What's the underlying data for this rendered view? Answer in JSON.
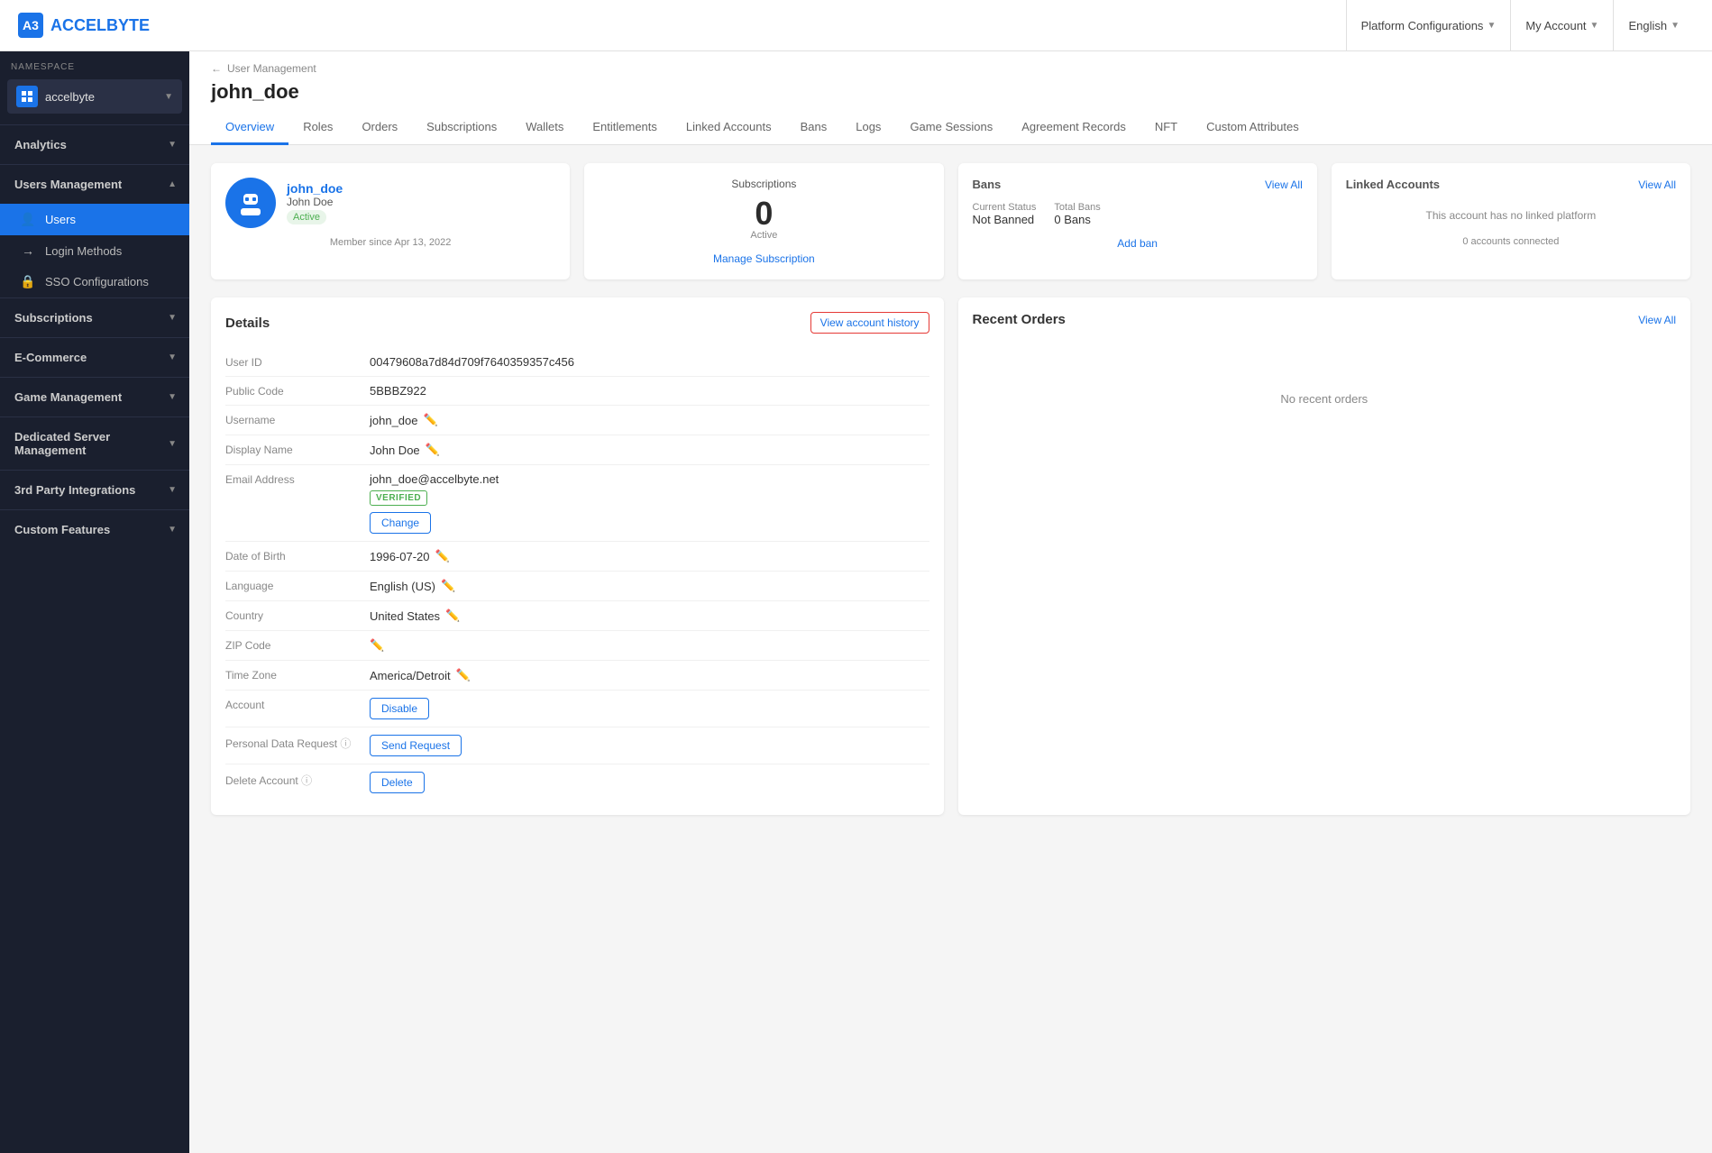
{
  "topnav": {
    "brand": "ACCELBYTE",
    "platform_configs_label": "Platform Configurations",
    "my_account_label": "My Account",
    "language_label": "English"
  },
  "sidebar": {
    "namespace_label": "NAMESPACE",
    "namespace_value": "accelbyte",
    "sections": [
      {
        "id": "analytics",
        "label": "Analytics",
        "expanded": false,
        "items": []
      },
      {
        "id": "users-management",
        "label": "Users Management",
        "expanded": true,
        "items": [
          {
            "id": "users",
            "label": "Users",
            "icon": "👤",
            "active": true
          },
          {
            "id": "login-methods",
            "label": "Login Methods",
            "icon": "🔑",
            "active": false
          },
          {
            "id": "sso-configurations",
            "label": "SSO Configurations",
            "icon": "🔒",
            "active": false
          }
        ]
      },
      {
        "id": "subscriptions",
        "label": "Subscriptions",
        "expanded": false,
        "items": []
      },
      {
        "id": "ecommerce",
        "label": "E-Commerce",
        "expanded": false,
        "items": []
      },
      {
        "id": "game-management",
        "label": "Game Management",
        "expanded": false,
        "items": []
      },
      {
        "id": "dedicated-server",
        "label": "Dedicated Server Management",
        "expanded": false,
        "items": []
      },
      {
        "id": "3rd-party",
        "label": "3rd Party Integrations",
        "expanded": false,
        "items": []
      },
      {
        "id": "custom-features",
        "label": "Custom Features",
        "expanded": false,
        "items": []
      }
    ]
  },
  "breadcrumb": {
    "parent": "User Management",
    "arrow": "←"
  },
  "page": {
    "title": "john_doe",
    "tabs": [
      {
        "id": "overview",
        "label": "Overview",
        "active": true
      },
      {
        "id": "roles",
        "label": "Roles",
        "active": false
      },
      {
        "id": "orders",
        "label": "Orders",
        "active": false
      },
      {
        "id": "subscriptions",
        "label": "Subscriptions",
        "active": false
      },
      {
        "id": "wallets",
        "label": "Wallets",
        "active": false
      },
      {
        "id": "entitlements",
        "label": "Entitlements",
        "active": false
      },
      {
        "id": "linked-accounts",
        "label": "Linked Accounts",
        "active": false
      },
      {
        "id": "bans",
        "label": "Bans",
        "active": false
      },
      {
        "id": "logs",
        "label": "Logs",
        "active": false
      },
      {
        "id": "game-sessions",
        "label": "Game Sessions",
        "active": false
      },
      {
        "id": "agreement-records",
        "label": "Agreement Records",
        "active": false
      },
      {
        "id": "nft",
        "label": "NFT",
        "active": false
      },
      {
        "id": "custom-attributes",
        "label": "Custom Attributes",
        "active": false
      }
    ]
  },
  "user_card": {
    "username": "john_doe",
    "display_name": "John Doe",
    "status": "Active",
    "member_since": "Member since Apr 13, 2022"
  },
  "subscriptions_card": {
    "title": "Subscriptions",
    "count": "0",
    "label": "Active",
    "manage_link": "Manage Subscription"
  },
  "bans_card": {
    "title": "Bans",
    "view_all": "View All",
    "current_status_label": "Current Status",
    "current_status_value": "Not Banned",
    "total_bans_label": "Total Bans",
    "total_bans_value": "0 Bans",
    "add_ban": "Add ban"
  },
  "linked_accounts_card": {
    "title": "Linked Accounts",
    "view_all": "View All",
    "no_platform_message": "This account has no linked platform",
    "accounts_connected": "0 accounts connected"
  },
  "details": {
    "title": "Details",
    "view_history_btn": "View account history",
    "fields": [
      {
        "label": "User ID",
        "value": "00479608a7d84d709f7640359357c456",
        "editable": false
      },
      {
        "label": "Public Code",
        "value": "5BBBZ922",
        "editable": false
      },
      {
        "label": "Username",
        "value": "john_doe",
        "editable": true
      },
      {
        "label": "Display Name",
        "value": "John Doe",
        "editable": true
      },
      {
        "label": "Email Address",
        "value": "john_doe@accelbyte.net",
        "editable": false,
        "verified": true,
        "has_change_btn": true
      },
      {
        "label": "Date of Birth",
        "value": "1996-07-20",
        "editable": true
      },
      {
        "label": "Language",
        "value": "English (US)",
        "editable": true
      },
      {
        "label": "Country",
        "value": "United States",
        "editable": true
      },
      {
        "label": "ZIP Code",
        "value": "",
        "editable": true
      },
      {
        "label": "Time Zone",
        "value": "America/Detroit",
        "editable": true
      },
      {
        "label": "Account",
        "value": "",
        "has_disable_btn": true
      },
      {
        "label": "Personal Data Request",
        "value": "",
        "has_info": true,
        "has_send_btn": true
      },
      {
        "label": "Delete Account",
        "value": "",
        "has_info": true,
        "has_delete_btn": true
      }
    ],
    "change_btn_label": "Change",
    "disable_btn_label": "Disable",
    "send_request_btn_label": "Send Request",
    "delete_btn_label": "Delete",
    "verified_label": "VERIFIED"
  },
  "recent_orders": {
    "title": "Recent Orders",
    "view_all": "View All",
    "no_orders_message": "No recent orders"
  }
}
